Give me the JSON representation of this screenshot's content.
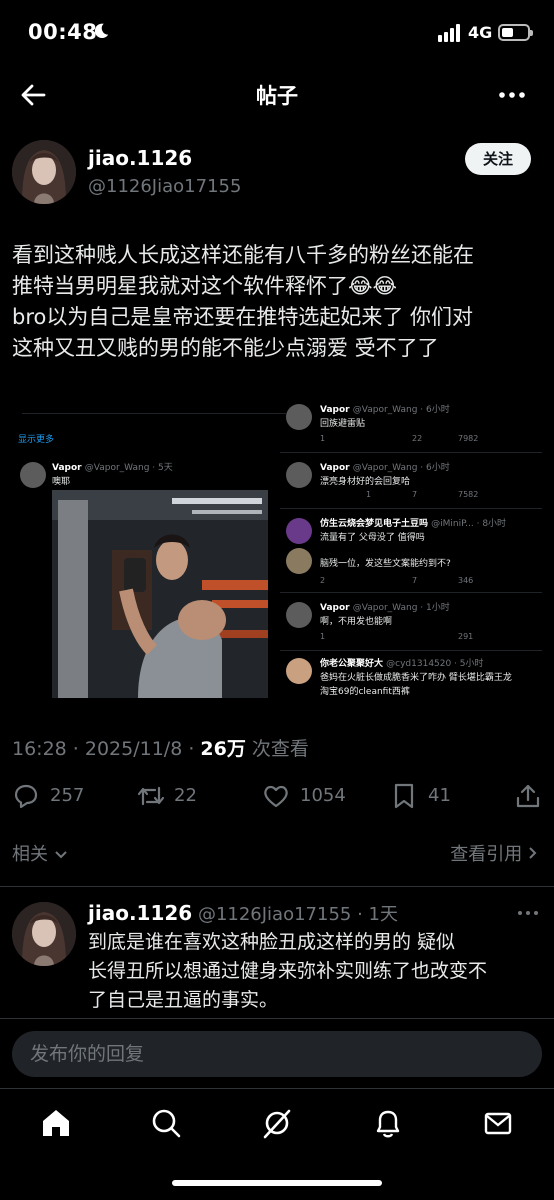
{
  "status_bar": {
    "time": "00:48",
    "network": "4G"
  },
  "header": {
    "title": "帖子"
  },
  "post": {
    "display_name": "jiao.1126",
    "handle": "@1126Jiao17155",
    "follow_label": "关注",
    "text_line1": "看到这种贱人长成这样还能有八千多的粉丝还能在",
    "text_line2": "推特当男明星我就对这个软件释怀了😂😂",
    "text_line3": "bro以为自己是皇帝还要在推特选起妃来了 你们对",
    "text_line4": "这种又丑又贱的男的能不能少点溺爱 受不了了",
    "timestamp": "16:28 · 2025/11/8 · ",
    "views_count": "26万",
    "views_label": " 次查看",
    "replies": "257",
    "reposts": "22",
    "likes": "1054",
    "bookmarks": "41",
    "related_label": "相关",
    "quotes_label": "查看引用"
  },
  "embedded": {
    "show_more": "显示更多",
    "left_tweet": {
      "name": "Vapor",
      "handle": "@Vapor_Wang · 5天",
      "text": "噢耶"
    },
    "right_tweets": [
      {
        "name": "Vapor",
        "handle": "@Vapor_Wang · 6小时",
        "text": "回族避雷贴",
        "stats": [
          "1",
          "",
          "22",
          "7982"
        ]
      },
      {
        "name": "Vapor",
        "handle": "@Vapor_Wang · 6小时",
        "text": "漂亮身材好的会回复哈",
        "stats": [
          "",
          "1",
          "7",
          "7582"
        ]
      },
      {
        "name": "仿生云烧会梦见电子土豆吗",
        "handle": "@iMiniP... · 8小时",
        "text": "流量有了 父母没了 值得吗",
        "stats": []
      },
      {
        "name": "",
        "handle": "",
        "text": "脑残一位，发这些文案能约到不?",
        "stats": [
          "2",
          "",
          "7",
          "346"
        ]
      },
      {
        "name": "Vapor",
        "handle": "@Vapor_Wang · 1小时",
        "text": "啊，不用发也能啊",
        "stats": [
          "1",
          "",
          "",
          "291"
        ]
      },
      {
        "name": "你老公聚聚好大",
        "handle": "@cyd1314520 · 5小时",
        "text": "爸妈在火脏长做成脆香米了咋办 臂长堪比霸王龙",
        "text2": "淘宝69的cleanfit西裤",
        "stats": []
      }
    ]
  },
  "reply": {
    "display_name": "jiao.1126",
    "handle_time": " @1126Jiao17155 · 1天",
    "text_line1": "到底是谁在喜欢这种脸丑成这样的男的 疑似",
    "text_line2": "长得丑所以想通过健身来弥补实则练了也改变不",
    "text_line3": "了自己是丑逼的事实。"
  },
  "composer": {
    "placeholder": "发布你的回复"
  },
  "nav": {
    "items": [
      "home-icon",
      "search-icon",
      "grok-icon",
      "notifications-icon",
      "messages-icon"
    ]
  },
  "colors": {
    "background": "#000000",
    "text": "#e7e9ea",
    "muted": "#71767b",
    "accent": "#1d9bf0"
  }
}
